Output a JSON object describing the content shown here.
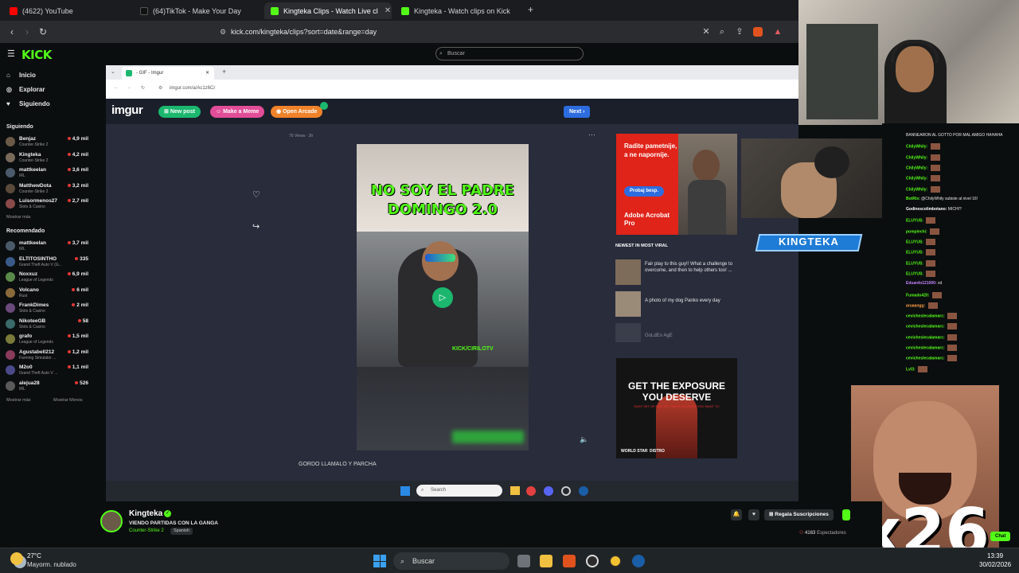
{
  "browser": {
    "tabs": [
      {
        "label": "(4622) YouTube",
        "color": "#ff0000",
        "active": false
      },
      {
        "label": "(64)TikTok - Make Your Day",
        "color": "#222222",
        "active": false
      },
      {
        "label": "Kingteka Clips - Watch Live cl",
        "color": "#53fc18",
        "active": true
      },
      {
        "label": "Kingteka - Watch clips on Kick",
        "color": "#53fc18",
        "active": false
      }
    ],
    "new_tab": "+",
    "url": "kick.com/kingteka/clips?sort=date&range=day"
  },
  "kick": {
    "logo": "KICK",
    "search_placeholder": "Buscar",
    "nav": [
      {
        "label": "Inicio",
        "icon": "home-icon"
      },
      {
        "label": "Explorar",
        "icon": "compass-icon"
      },
      {
        "label": "Siguiendo",
        "icon": "heart-icon"
      }
    ],
    "following_heading": "Siguiendo",
    "following": [
      {
        "name": "Benjaz",
        "game": "Counter-Strike 2",
        "viewers": "4,9 mil",
        "color": "#6b5a48"
      },
      {
        "name": "Kingteka",
        "game": "Counter-Strike 2",
        "viewers": "4,2 mil",
        "color": "#7a6a5a"
      },
      {
        "name": "mattkeelan",
        "game": "IRL",
        "viewers": "3,6 mil",
        "color": "#4a5a6a"
      },
      {
        "name": "MatthewDota",
        "game": "Counter-Strike 2",
        "viewers": "3,2 mil",
        "color": "#5a4a3a"
      },
      {
        "name": "Luisormenos27",
        "game": "Slots & Casino",
        "viewers": "2,7 mil",
        "color": "#8a4a4a"
      }
    ],
    "show_more": "Mostrar más",
    "recommended_heading": "Recomendado",
    "recommended": [
      {
        "name": "mattkeelan",
        "game": "IRL",
        "viewers": "3,7 mil",
        "color": "#4a5a6a"
      },
      {
        "name": "ELTITOSINTHO",
        "game": "Grand Theft Auto V (G...",
        "viewers": "335",
        "color": "#3a5a8a"
      },
      {
        "name": "Noxxuz",
        "game": "League of Legends",
        "viewers": "6,9 mil",
        "color": "#5a8a4a"
      },
      {
        "name": "Volcano",
        "game": "Rust",
        "viewers": "6 mil",
        "color": "#8a6a3a"
      },
      {
        "name": "FrankDimes",
        "game": "Slots & Casino",
        "viewers": "2 mil",
        "color": "#6a4a7a"
      },
      {
        "name": "NikoteeGB",
        "game": "Slots & Casino",
        "viewers": "58",
        "color": "#3a6a6a"
      },
      {
        "name": "grafo",
        "game": "League of Legends",
        "viewers": "1,5 mil",
        "color": "#7a7a3a"
      },
      {
        "name": "Agustabell212",
        "game": "Farming Simulator ...",
        "viewers": "1,2 mil",
        "color": "#8a3a5a"
      },
      {
        "name": "M2o0",
        "game": "Grand Theft Auto V ...",
        "viewers": "1,1 mil",
        "color": "#4a4a8a"
      },
      {
        "name": "alejua28",
        "game": "IRL",
        "viewers": "526",
        "color": "#5a5a5a"
      }
    ],
    "show_more_2": "Mostrar más",
    "show_less": "Mostrar Menos"
  },
  "inner_browser": {
    "tab_label": "- GIF - Imgur",
    "url": "imgur.com/a/Ac1z6Cr",
    "imgur_logo": "imgur",
    "new_post": "New post",
    "make_meme": "Make a Meme",
    "open_arcade": "Open Arcade",
    "next": "Next",
    "views": "76 Views · 3h",
    "video_text_line1": "NO SOY EL PADRE",
    "video_text_line2": "DOMINGO 2.0",
    "watermark": "KICK/CIRILOTV",
    "caption": "GORDO LLAMALO Y PARCHA",
    "ad1_text": "Radite pametnije, a ne napornije.",
    "ad1_button": "Probaj besp.",
    "ad1_brand": "Adobe Acrobat Pro",
    "viral_heading": "NEWEST IN MOST VIRAL",
    "viral": [
      "Fair play to this guy!! What a challenge to overcome, and then to help others too! ...",
      "A photo of my dog Panko every day",
      "GoLdEn AgE"
    ],
    "ad2_line1": "GET THE EXPOSURE",
    "ad2_line2": "YOU DESERVE",
    "ad2_small": "EASY SET UP AND GET PAID $ $ $ WHEN YOU WANT TO",
    "ad2_brand1": "WORLD STAR",
    "ad2_brand2": "DISTRO",
    "search_label": "Search"
  },
  "streamer_banner": "KINGTEKA",
  "chat": {
    "messages": [
      {
        "user": "",
        "text": "BANNEARON AL GOTTO POR MAL AMIGO HAHAHA",
        "color": "#ff5a5a"
      },
      {
        "user": "ChilyWhily:",
        "text": "",
        "color": "#53fc18"
      },
      {
        "user": "ChilyWhily:",
        "text": "",
        "color": "#53fc18"
      },
      {
        "user": "ChilyWhily:",
        "text": "",
        "color": "#53fc18"
      },
      {
        "user": "ChilyWhily:",
        "text": "",
        "color": "#53fc18"
      },
      {
        "user": "ChilyWhily:",
        "text": "",
        "color": "#53fc18"
      },
      {
        "user": "BotRix:",
        "text": "@ChilyWhily subiste al nivel 16!",
        "color": "#53fc18"
      },
      {
        "user": "Godinescolimbotano:",
        "text": "MICHI?",
        "color": "#ffffff"
      },
      {
        "user": "ELUYUS:",
        "text": "",
        "color": "#53fc18"
      },
      {
        "user": "pompiechi:",
        "text": "",
        "color": "#53fc18"
      },
      {
        "user": "ELUYUS:",
        "text": "",
        "color": "#53fc18"
      },
      {
        "user": "ELUYUS:",
        "text": "",
        "color": "#53fc18"
      },
      {
        "user": "ELUYUS:",
        "text": "",
        "color": "#53fc18"
      },
      {
        "user": "ELUYUS:",
        "text": "",
        "color": "#53fc18"
      },
      {
        "user": "Eduardo121000:",
        "text": "xd",
        "color": "#c084fc"
      },
      {
        "user": "Fumado420:",
        "text": "",
        "color": "#53fc18"
      },
      {
        "user": "aruaangg:",
        "text": "",
        "color": "#ff9f43"
      },
      {
        "user": "cevicheslecalamarc:",
        "text": "",
        "color": "#53fc18"
      },
      {
        "user": "cevicheslecalamarc:",
        "text": "",
        "color": "#53fc18"
      },
      {
        "user": "cevicheslecalamarc:",
        "text": "",
        "color": "#53fc18"
      },
      {
        "user": "cevicheslecalamarc:",
        "text": "",
        "color": "#53fc18"
      },
      {
        "user": "cevicheslecalamarc:",
        "text": "",
        "color": "#53fc18"
      },
      {
        "user": "Lvl3:",
        "text": "",
        "color": "#53fc18"
      }
    ]
  },
  "channel": {
    "name": "Kingteka",
    "title": "VIENDO PARTIDAS CON LA GANGA",
    "category": "Counter-Strike 2",
    "language": "Spanish",
    "subscribe_gift": "Regala Suscripciones",
    "viewers": "4163",
    "viewers_label": "Espectadores",
    "chat_button": "Chat"
  },
  "overlay_text": "x26",
  "taskbar": {
    "weather_temp": "27°C",
    "weather_desc": "Mayorm. nublado",
    "search_placeholder": "Buscar",
    "time": "13:39",
    "date": "30/02/2026"
  }
}
